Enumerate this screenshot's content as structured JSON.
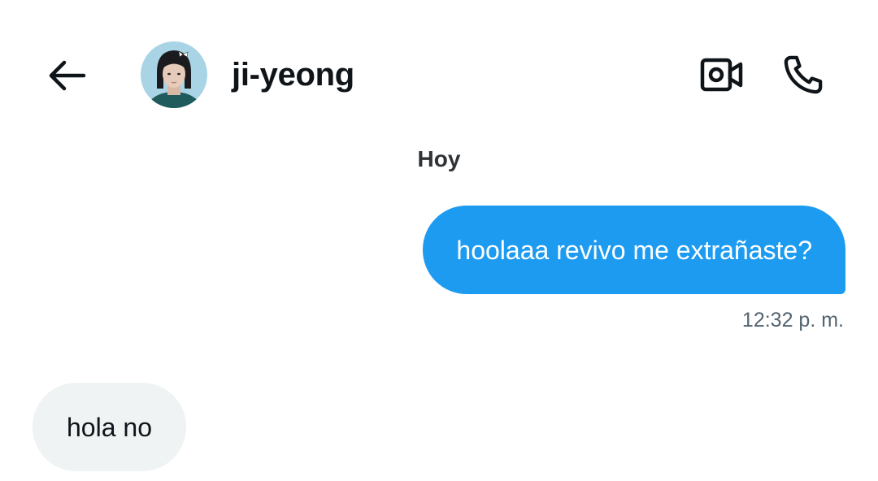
{
  "header": {
    "back_icon": "arrow-left-icon",
    "avatar_icon": "contact-avatar",
    "contact_name": "ji-yeong",
    "video_icon": "video-camera-icon",
    "call_icon": "phone-icon"
  },
  "conversation": {
    "date_separator": "Hoy",
    "messages": [
      {
        "direction": "outgoing",
        "text": "hoolaaa revivo me extrañaste?",
        "time": "12:32 p. m."
      },
      {
        "direction": "incoming",
        "text": "hola no"
      }
    ]
  },
  "colors": {
    "outgoing_bubble": "#1d9bf0",
    "incoming_bubble": "#eff3f4",
    "text_primary": "#0f1419",
    "text_secondary": "#536471"
  }
}
